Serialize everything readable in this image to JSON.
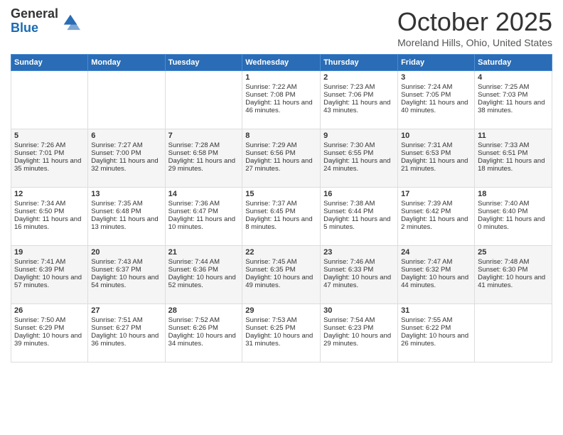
{
  "header": {
    "logo_general": "General",
    "logo_blue": "Blue",
    "month_title": "October 2025",
    "subtitle": "Moreland Hills, Ohio, United States"
  },
  "days_of_week": [
    "Sunday",
    "Monday",
    "Tuesday",
    "Wednesday",
    "Thursday",
    "Friday",
    "Saturday"
  ],
  "weeks": [
    [
      {
        "day": "",
        "sunrise": "",
        "sunset": "",
        "daylight": ""
      },
      {
        "day": "",
        "sunrise": "",
        "sunset": "",
        "daylight": ""
      },
      {
        "day": "",
        "sunrise": "",
        "sunset": "",
        "daylight": ""
      },
      {
        "day": "1",
        "sunrise": "Sunrise: 7:22 AM",
        "sunset": "Sunset: 7:08 PM",
        "daylight": "Daylight: 11 hours and 46 minutes."
      },
      {
        "day": "2",
        "sunrise": "Sunrise: 7:23 AM",
        "sunset": "Sunset: 7:06 PM",
        "daylight": "Daylight: 11 hours and 43 minutes."
      },
      {
        "day": "3",
        "sunrise": "Sunrise: 7:24 AM",
        "sunset": "Sunset: 7:05 PM",
        "daylight": "Daylight: 11 hours and 40 minutes."
      },
      {
        "day": "4",
        "sunrise": "Sunrise: 7:25 AM",
        "sunset": "Sunset: 7:03 PM",
        "daylight": "Daylight: 11 hours and 38 minutes."
      }
    ],
    [
      {
        "day": "5",
        "sunrise": "Sunrise: 7:26 AM",
        "sunset": "Sunset: 7:01 PM",
        "daylight": "Daylight: 11 hours and 35 minutes."
      },
      {
        "day": "6",
        "sunrise": "Sunrise: 7:27 AM",
        "sunset": "Sunset: 7:00 PM",
        "daylight": "Daylight: 11 hours and 32 minutes."
      },
      {
        "day": "7",
        "sunrise": "Sunrise: 7:28 AM",
        "sunset": "Sunset: 6:58 PM",
        "daylight": "Daylight: 11 hours and 29 minutes."
      },
      {
        "day": "8",
        "sunrise": "Sunrise: 7:29 AM",
        "sunset": "Sunset: 6:56 PM",
        "daylight": "Daylight: 11 hours and 27 minutes."
      },
      {
        "day": "9",
        "sunrise": "Sunrise: 7:30 AM",
        "sunset": "Sunset: 6:55 PM",
        "daylight": "Daylight: 11 hours and 24 minutes."
      },
      {
        "day": "10",
        "sunrise": "Sunrise: 7:31 AM",
        "sunset": "Sunset: 6:53 PM",
        "daylight": "Daylight: 11 hours and 21 minutes."
      },
      {
        "day": "11",
        "sunrise": "Sunrise: 7:33 AM",
        "sunset": "Sunset: 6:51 PM",
        "daylight": "Daylight: 11 hours and 18 minutes."
      }
    ],
    [
      {
        "day": "12",
        "sunrise": "Sunrise: 7:34 AM",
        "sunset": "Sunset: 6:50 PM",
        "daylight": "Daylight: 11 hours and 16 minutes."
      },
      {
        "day": "13",
        "sunrise": "Sunrise: 7:35 AM",
        "sunset": "Sunset: 6:48 PM",
        "daylight": "Daylight: 11 hours and 13 minutes."
      },
      {
        "day": "14",
        "sunrise": "Sunrise: 7:36 AM",
        "sunset": "Sunset: 6:47 PM",
        "daylight": "Daylight: 11 hours and 10 minutes."
      },
      {
        "day": "15",
        "sunrise": "Sunrise: 7:37 AM",
        "sunset": "Sunset: 6:45 PM",
        "daylight": "Daylight: 11 hours and 8 minutes."
      },
      {
        "day": "16",
        "sunrise": "Sunrise: 7:38 AM",
        "sunset": "Sunset: 6:44 PM",
        "daylight": "Daylight: 11 hours and 5 minutes."
      },
      {
        "day": "17",
        "sunrise": "Sunrise: 7:39 AM",
        "sunset": "Sunset: 6:42 PM",
        "daylight": "Daylight: 11 hours and 2 minutes."
      },
      {
        "day": "18",
        "sunrise": "Sunrise: 7:40 AM",
        "sunset": "Sunset: 6:40 PM",
        "daylight": "Daylight: 11 hours and 0 minutes."
      }
    ],
    [
      {
        "day": "19",
        "sunrise": "Sunrise: 7:41 AM",
        "sunset": "Sunset: 6:39 PM",
        "daylight": "Daylight: 10 hours and 57 minutes."
      },
      {
        "day": "20",
        "sunrise": "Sunrise: 7:43 AM",
        "sunset": "Sunset: 6:37 PM",
        "daylight": "Daylight: 10 hours and 54 minutes."
      },
      {
        "day": "21",
        "sunrise": "Sunrise: 7:44 AM",
        "sunset": "Sunset: 6:36 PM",
        "daylight": "Daylight: 10 hours and 52 minutes."
      },
      {
        "day": "22",
        "sunrise": "Sunrise: 7:45 AM",
        "sunset": "Sunset: 6:35 PM",
        "daylight": "Daylight: 10 hours and 49 minutes."
      },
      {
        "day": "23",
        "sunrise": "Sunrise: 7:46 AM",
        "sunset": "Sunset: 6:33 PM",
        "daylight": "Daylight: 10 hours and 47 minutes."
      },
      {
        "day": "24",
        "sunrise": "Sunrise: 7:47 AM",
        "sunset": "Sunset: 6:32 PM",
        "daylight": "Daylight: 10 hours and 44 minutes."
      },
      {
        "day": "25",
        "sunrise": "Sunrise: 7:48 AM",
        "sunset": "Sunset: 6:30 PM",
        "daylight": "Daylight: 10 hours and 41 minutes."
      }
    ],
    [
      {
        "day": "26",
        "sunrise": "Sunrise: 7:50 AM",
        "sunset": "Sunset: 6:29 PM",
        "daylight": "Daylight: 10 hours and 39 minutes."
      },
      {
        "day": "27",
        "sunrise": "Sunrise: 7:51 AM",
        "sunset": "Sunset: 6:27 PM",
        "daylight": "Daylight: 10 hours and 36 minutes."
      },
      {
        "day": "28",
        "sunrise": "Sunrise: 7:52 AM",
        "sunset": "Sunset: 6:26 PM",
        "daylight": "Daylight: 10 hours and 34 minutes."
      },
      {
        "day": "29",
        "sunrise": "Sunrise: 7:53 AM",
        "sunset": "Sunset: 6:25 PM",
        "daylight": "Daylight: 10 hours and 31 minutes."
      },
      {
        "day": "30",
        "sunrise": "Sunrise: 7:54 AM",
        "sunset": "Sunset: 6:23 PM",
        "daylight": "Daylight: 10 hours and 29 minutes."
      },
      {
        "day": "31",
        "sunrise": "Sunrise: 7:55 AM",
        "sunset": "Sunset: 6:22 PM",
        "daylight": "Daylight: 10 hours and 26 minutes."
      },
      {
        "day": "",
        "sunrise": "",
        "sunset": "",
        "daylight": ""
      }
    ]
  ]
}
